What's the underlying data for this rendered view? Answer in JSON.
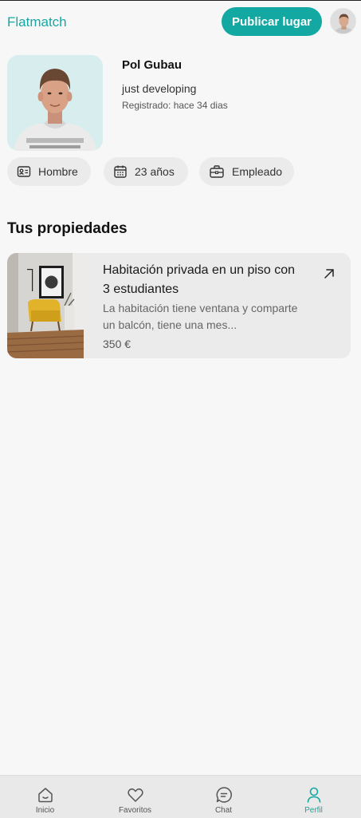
{
  "header": {
    "brand": "Flatmatch",
    "publish_label": "Publicar lugar"
  },
  "profile": {
    "name": "Pol Gubau",
    "bio": "just developing",
    "registered": "Registrado: hace 34 dias",
    "chips": {
      "gender": "Hombre",
      "age": "23 años",
      "job": "Empleado"
    }
  },
  "properties": {
    "title": "Tus propiedades",
    "items": [
      {
        "title": "Habitación privada en un piso con 3 estudiantes",
        "description": "La habitación tiene ventana y comparte un balcón, tiene una mes...",
        "price": "350 €"
      }
    ]
  },
  "nav": {
    "items": [
      {
        "label": "Inicio",
        "icon": "home-icon"
      },
      {
        "label": "Favoritos",
        "icon": "heart-icon"
      },
      {
        "label": "Chat",
        "icon": "chat-icon"
      },
      {
        "label": "Perfil",
        "icon": "user-icon"
      }
    ],
    "active": "Perfil"
  },
  "colors": {
    "accent": "#13a8a1",
    "background": "#f7f7f7",
    "chip": "#ebebeb"
  }
}
